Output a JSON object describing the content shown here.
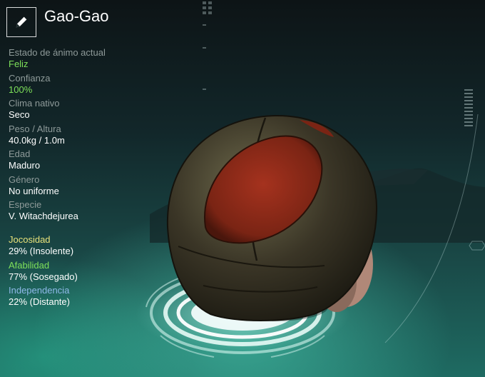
{
  "creature": {
    "name": "Gao-Gao"
  },
  "attributes": [
    {
      "label": "Estado de ánimo actual",
      "value": "Feliz"
    },
    {
      "label": "Confianza",
      "value": "100%"
    },
    {
      "label": "Clima nativo",
      "value": "Seco"
    },
    {
      "label": "Peso / Altura",
      "value": "40.0kg / 1.0m"
    },
    {
      "label": "Edad",
      "value": "Maduro"
    },
    {
      "label": "Género",
      "value": "No uniforme"
    },
    {
      "label": "Especie",
      "value": "V. Witachdejurea"
    }
  ],
  "traits": [
    {
      "label": "Jocosidad",
      "value": "29% (Insolente)"
    },
    {
      "label": "Afabilidad",
      "value": "77% (Sosegado)"
    },
    {
      "label": "Independencia",
      "value": "22% (Distante)"
    }
  ],
  "colors": {
    "highlight_green": "#7ee05a",
    "jocosity": "#e8e27a",
    "affability": "#7ee05a",
    "independence": "#8fb8e8"
  },
  "icons": {
    "edit": "pencil-icon"
  }
}
